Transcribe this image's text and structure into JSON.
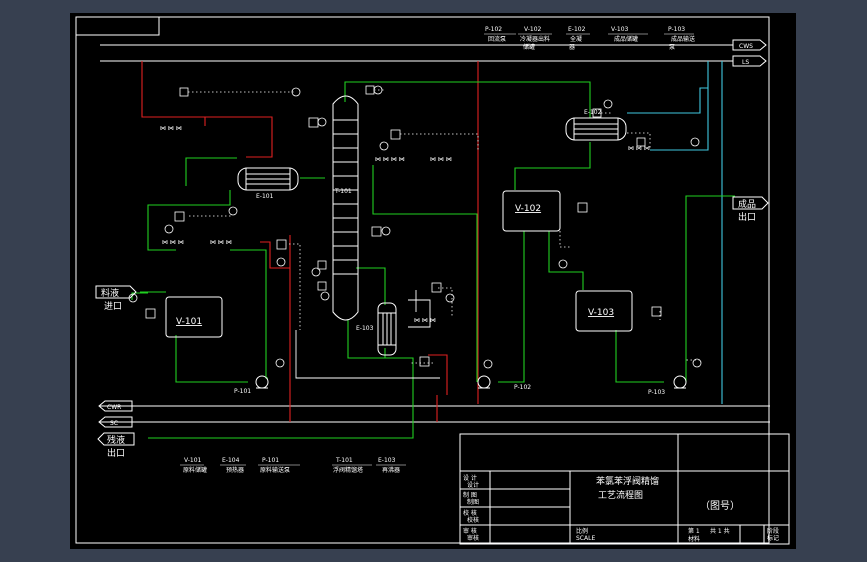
{
  "colors": {
    "background": "#374050",
    "canvas": "#000000",
    "line": "#ffffff",
    "steam": "#e02020",
    "process": "#20d020",
    "water": "#40c8e0",
    "instrument": "#ffff66"
  },
  "top_legend": {
    "pumps": [
      {
        "tag": "P-102",
        "name": "回流泵"
      },
      {
        "tag": "V-102",
        "name": "冷凝器出料"
      },
      {
        "tag": "E-102",
        "name": "全凝"
      },
      {
        "tag": "V-103",
        "name": "成品储罐"
      },
      {
        "tag": "P-103",
        "name": "成品输送"
      }
    ],
    "row2": [
      "储罐",
      "器",
      "泵"
    ]
  },
  "utility_lines": {
    "cws": "CWS",
    "ls": "LS",
    "cwr": "CWR",
    "sc": "SC"
  },
  "equipment": {
    "e101": "E-101",
    "t101": "T-101",
    "e103": "E-103",
    "e102": "E-102",
    "v102": "V-102",
    "v101": "V-101",
    "v103": "V-103",
    "p101": "P-101",
    "p102": "P-102",
    "p103": "P-103"
  },
  "ports": {
    "feed": "料液",
    "feed_sub": "进口",
    "product": "成品",
    "product_sub": "出口",
    "residue": "残液",
    "residue_sub": "出口"
  },
  "bottom_legend": [
    {
      "tag": "V-101",
      "name": "原料储罐"
    },
    {
      "tag": "E-104",
      "name": "预热器"
    },
    {
      "tag": "P-101",
      "name": "原料输送泵"
    },
    {
      "tag": "T-101",
      "name": "浮阀精馏塔"
    },
    {
      "tag": "E-103",
      "name": "再沸器"
    }
  ],
  "title_block": {
    "title_line1": "苯氯苯浮阀精馏",
    "title_line2": "工艺流程图",
    "drawing_no": "（图号）",
    "rows": [
      {
        "label": "设  计",
        "sub": "设计"
      },
      {
        "label": "制  图",
        "sub": "制图"
      },
      {
        "label": "校  核",
        "sub": "校核"
      },
      {
        "label": "审  核",
        "sub": "审核"
      }
    ],
    "ratio_label": "比例",
    "ratio_sub": "SCALE",
    "sheet_label": "第 1",
    "total_label": "共 1 共",
    "date_label": "材料",
    "marks_label": "阶段",
    "marks_sub": "标记"
  }
}
